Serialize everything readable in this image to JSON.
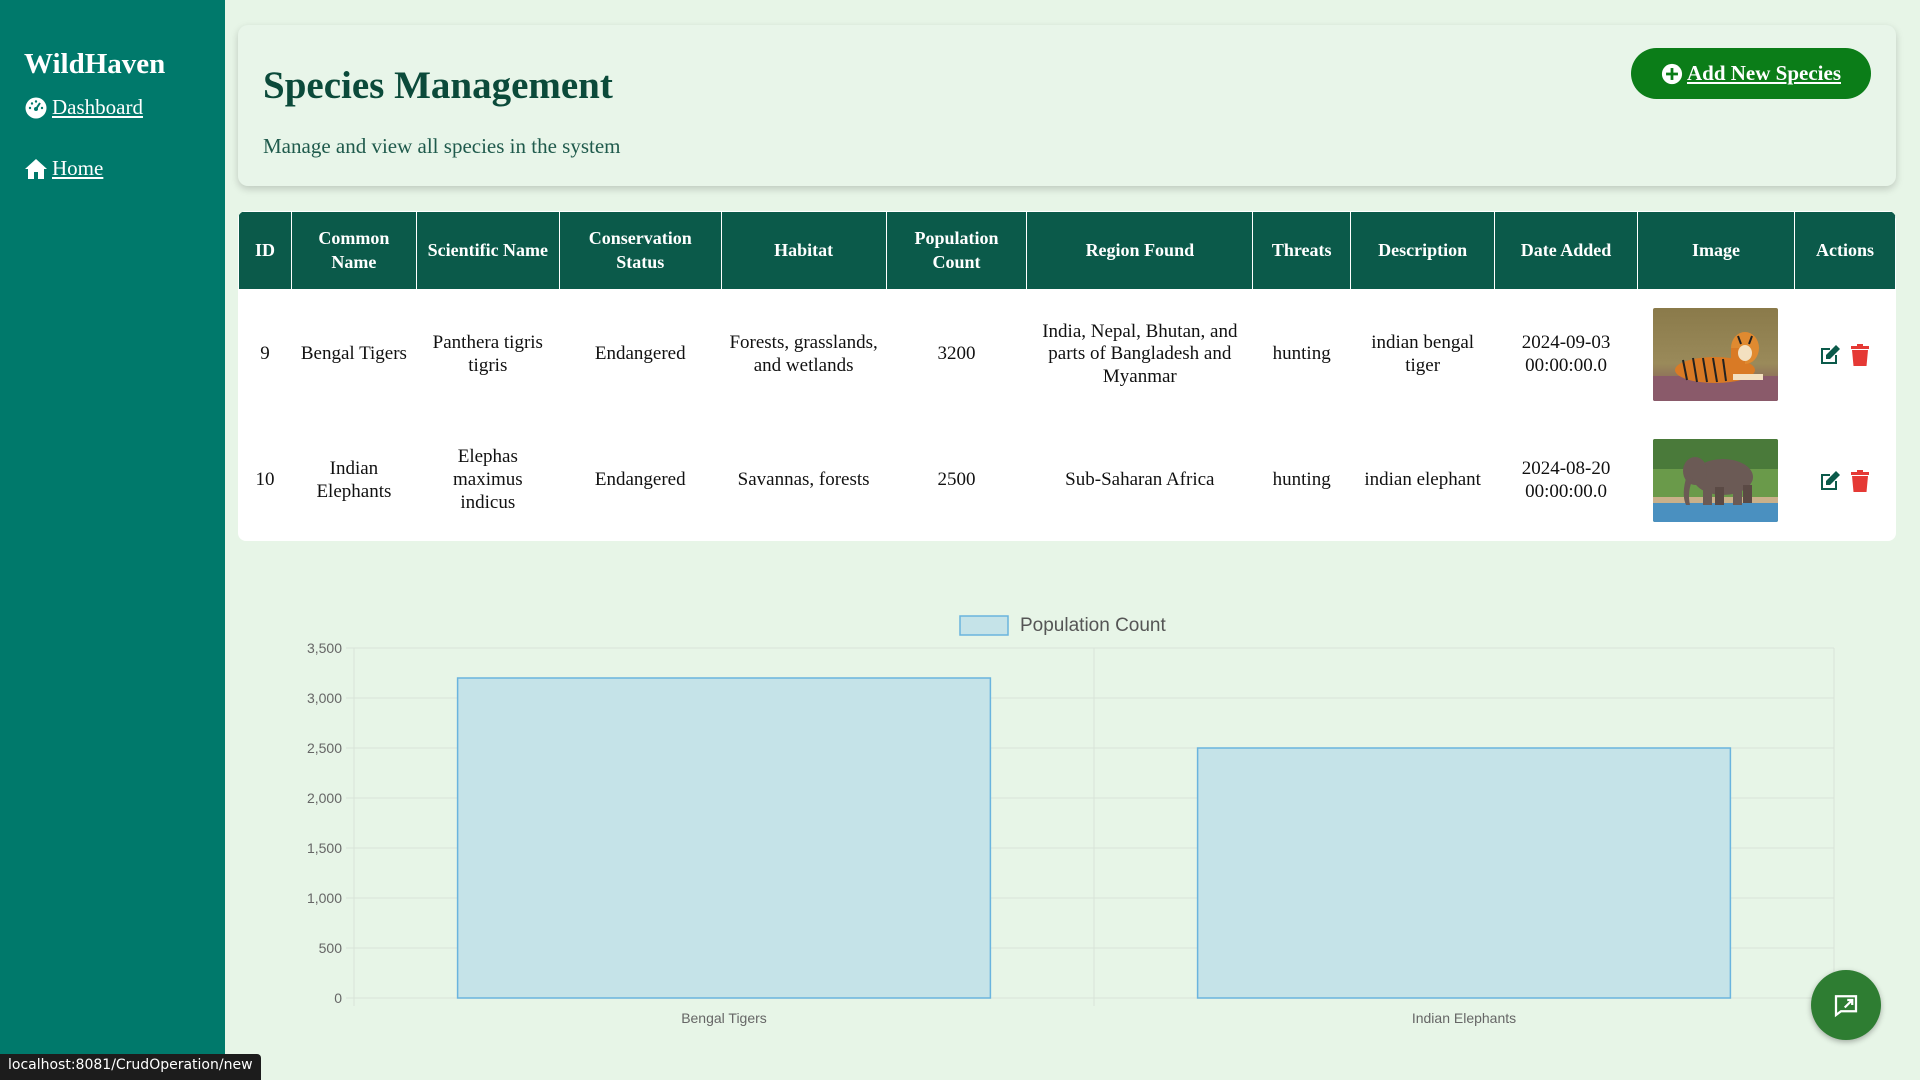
{
  "sidebar": {
    "brand": "WildHaven",
    "items": [
      {
        "label": "Dashboard",
        "icon": "dashboard-gauge-icon"
      },
      {
        "label": "Home",
        "icon": "home-icon"
      }
    ]
  },
  "header": {
    "title": "Species Management",
    "subtitle": "Manage and view all species in the system",
    "add_button_label": "Add New Species"
  },
  "table": {
    "columns": [
      "ID",
      "Common Name",
      "Scientific Name",
      "Conservation Status",
      "Habitat",
      "Population Count",
      "Region Found",
      "Threats",
      "Description",
      "Date Added",
      "Image",
      "Actions"
    ],
    "rows": [
      {
        "id": "9",
        "common_name": "Bengal Tigers",
        "scientific_name": "Panthera tigris tigris",
        "status": "Endangered",
        "habitat": "Forests, grasslands, and wetlands",
        "population": "3200",
        "region": "India, Nepal, Bhutan, and parts of Bangladesh and Myanmar",
        "threats": "hunting",
        "description": "indian bengal tiger",
        "date_added": "2024-09-03 00:00:00.0",
        "image": "tiger-photo"
      },
      {
        "id": "10",
        "common_name": "Indian Elephants",
        "scientific_name": "Elephas maximus indicus",
        "status": "Endangered",
        "habitat": "Savannas, forests",
        "population": "2500",
        "region": "Sub-Saharan Africa",
        "threats": "hunting",
        "description": "indian elephant",
        "date_added": "2024-08-20 00:00:00.0",
        "image": "elephant-photo"
      }
    ]
  },
  "chart_data": {
    "type": "bar",
    "categories": [
      "Bengal Tigers",
      "Indian Elephants"
    ],
    "series": [
      {
        "name": "Population Count",
        "values": [
          3200,
          2500
        ]
      }
    ],
    "ylim": [
      0,
      3500
    ],
    "yticks": [
      0,
      500,
      1000,
      1500,
      2000,
      2500,
      3000,
      3500
    ],
    "ytick_labels": [
      "0",
      "500",
      "1,000",
      "1,500",
      "2,000",
      "2,500",
      "3,000",
      "3,500"
    ],
    "legend": "top-center",
    "grid": true,
    "bar_fill": "#c5e3e8",
    "bar_stroke": "#6ab4de"
  },
  "status_url": "localhost:8081/CrudOperation/new",
  "colors": {
    "sidebar": "#00796b",
    "table_header": "#0b5a4a",
    "add_button": "#0b7d18",
    "delete_icon": "#e53935",
    "fab": "#2e7d32"
  }
}
